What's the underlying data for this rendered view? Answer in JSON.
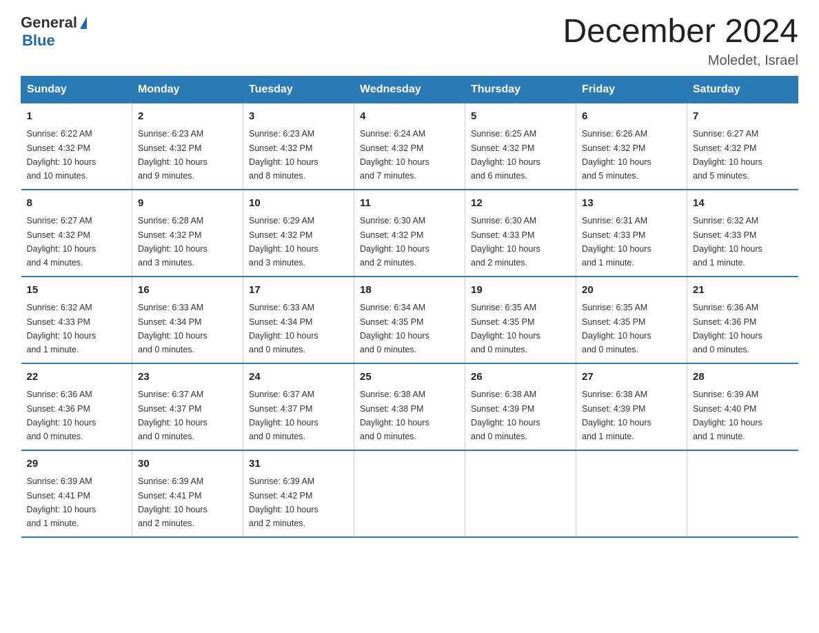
{
  "logo": {
    "general": "General",
    "blue": "Blue"
  },
  "header": {
    "month": "December 2024",
    "location": "Moledet, Israel"
  },
  "days_of_week": [
    "Sunday",
    "Monday",
    "Tuesday",
    "Wednesday",
    "Thursday",
    "Friday",
    "Saturday"
  ],
  "weeks": [
    [
      {
        "day": "1",
        "sunrise": "6:22 AM",
        "sunset": "4:32 PM",
        "daylight": "10 hours and 10 minutes."
      },
      {
        "day": "2",
        "sunrise": "6:23 AM",
        "sunset": "4:32 PM",
        "daylight": "10 hours and 9 minutes."
      },
      {
        "day": "3",
        "sunrise": "6:23 AM",
        "sunset": "4:32 PM",
        "daylight": "10 hours and 8 minutes."
      },
      {
        "day": "4",
        "sunrise": "6:24 AM",
        "sunset": "4:32 PM",
        "daylight": "10 hours and 7 minutes."
      },
      {
        "day": "5",
        "sunrise": "6:25 AM",
        "sunset": "4:32 PM",
        "daylight": "10 hours and 6 minutes."
      },
      {
        "day": "6",
        "sunrise": "6:26 AM",
        "sunset": "4:32 PM",
        "daylight": "10 hours and 5 minutes."
      },
      {
        "day": "7",
        "sunrise": "6:27 AM",
        "sunset": "4:32 PM",
        "daylight": "10 hours and 5 minutes."
      }
    ],
    [
      {
        "day": "8",
        "sunrise": "6:27 AM",
        "sunset": "4:32 PM",
        "daylight": "10 hours and 4 minutes."
      },
      {
        "day": "9",
        "sunrise": "6:28 AM",
        "sunset": "4:32 PM",
        "daylight": "10 hours and 3 minutes."
      },
      {
        "day": "10",
        "sunrise": "6:29 AM",
        "sunset": "4:32 PM",
        "daylight": "10 hours and 3 minutes."
      },
      {
        "day": "11",
        "sunrise": "6:30 AM",
        "sunset": "4:32 PM",
        "daylight": "10 hours and 2 minutes."
      },
      {
        "day": "12",
        "sunrise": "6:30 AM",
        "sunset": "4:33 PM",
        "daylight": "10 hours and 2 minutes."
      },
      {
        "day": "13",
        "sunrise": "6:31 AM",
        "sunset": "4:33 PM",
        "daylight": "10 hours and 1 minute."
      },
      {
        "day": "14",
        "sunrise": "6:32 AM",
        "sunset": "4:33 PM",
        "daylight": "10 hours and 1 minute."
      }
    ],
    [
      {
        "day": "15",
        "sunrise": "6:32 AM",
        "sunset": "4:33 PM",
        "daylight": "10 hours and 1 minute."
      },
      {
        "day": "16",
        "sunrise": "6:33 AM",
        "sunset": "4:34 PM",
        "daylight": "10 hours and 0 minutes."
      },
      {
        "day": "17",
        "sunrise": "6:33 AM",
        "sunset": "4:34 PM",
        "daylight": "10 hours and 0 minutes."
      },
      {
        "day": "18",
        "sunrise": "6:34 AM",
        "sunset": "4:35 PM",
        "daylight": "10 hours and 0 minutes."
      },
      {
        "day": "19",
        "sunrise": "6:35 AM",
        "sunset": "4:35 PM",
        "daylight": "10 hours and 0 minutes."
      },
      {
        "day": "20",
        "sunrise": "6:35 AM",
        "sunset": "4:35 PM",
        "daylight": "10 hours and 0 minutes."
      },
      {
        "day": "21",
        "sunrise": "6:36 AM",
        "sunset": "4:36 PM",
        "daylight": "10 hours and 0 minutes."
      }
    ],
    [
      {
        "day": "22",
        "sunrise": "6:36 AM",
        "sunset": "4:36 PM",
        "daylight": "10 hours and 0 minutes."
      },
      {
        "day": "23",
        "sunrise": "6:37 AM",
        "sunset": "4:37 PM",
        "daylight": "10 hours and 0 minutes."
      },
      {
        "day": "24",
        "sunrise": "6:37 AM",
        "sunset": "4:37 PM",
        "daylight": "10 hours and 0 minutes."
      },
      {
        "day": "25",
        "sunrise": "6:38 AM",
        "sunset": "4:38 PM",
        "daylight": "10 hours and 0 minutes."
      },
      {
        "day": "26",
        "sunrise": "6:38 AM",
        "sunset": "4:39 PM",
        "daylight": "10 hours and 0 minutes."
      },
      {
        "day": "27",
        "sunrise": "6:38 AM",
        "sunset": "4:39 PM",
        "daylight": "10 hours and 1 minute."
      },
      {
        "day": "28",
        "sunrise": "6:39 AM",
        "sunset": "4:40 PM",
        "daylight": "10 hours and 1 minute."
      }
    ],
    [
      {
        "day": "29",
        "sunrise": "6:39 AM",
        "sunset": "4:41 PM",
        "daylight": "10 hours and 1 minute."
      },
      {
        "day": "30",
        "sunrise": "6:39 AM",
        "sunset": "4:41 PM",
        "daylight": "10 hours and 2 minutes."
      },
      {
        "day": "31",
        "sunrise": "6:39 AM",
        "sunset": "4:42 PM",
        "daylight": "10 hours and 2 minutes."
      },
      null,
      null,
      null,
      null
    ]
  ],
  "labels": {
    "sunrise": "Sunrise:",
    "sunset": "Sunset:",
    "daylight": "Daylight:"
  }
}
